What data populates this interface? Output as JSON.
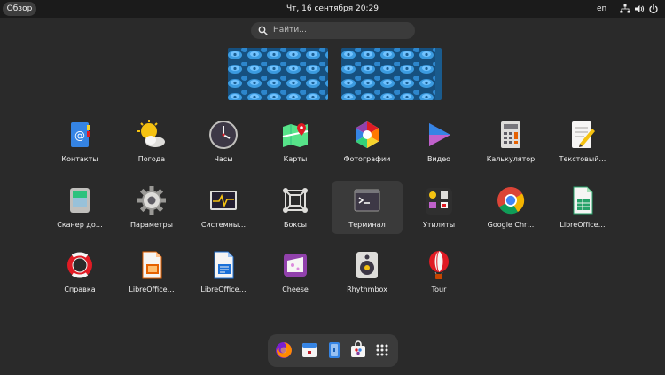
{
  "topbar": {
    "overview_label": "Обзор",
    "clock": "Чт, 16 сентября  20:29",
    "keyboard_layout": "en",
    "tray_icons": [
      "network-icon",
      "volume-icon",
      "power-icon"
    ]
  },
  "search": {
    "placeholder": "Найти..."
  },
  "workspaces": [
    {
      "name": "workspace-1"
    },
    {
      "name": "workspace-2"
    }
  ],
  "apps": [
    {
      "label": "Контакты",
      "icon": "contacts-icon"
    },
    {
      "label": "Погода",
      "icon": "weather-icon"
    },
    {
      "label": "Часы",
      "icon": "clock-icon"
    },
    {
      "label": "Карты",
      "icon": "maps-icon"
    },
    {
      "label": "Фотографии",
      "icon": "photos-icon"
    },
    {
      "label": "Видео",
      "icon": "videos-icon"
    },
    {
      "label": "Калькулятор",
      "icon": "calculator-icon"
    },
    {
      "label": "Текстовый…",
      "icon": "text-editor-icon"
    },
    {
      "label": "Сканер до…",
      "icon": "scanner-icon"
    },
    {
      "label": "Параметры",
      "icon": "settings-icon"
    },
    {
      "label": "Системны…",
      "icon": "system-monitor-icon"
    },
    {
      "label": "Боксы",
      "icon": "boxes-icon"
    },
    {
      "label": "Терминал",
      "icon": "terminal-icon",
      "selected": true
    },
    {
      "label": "Утилиты",
      "icon": "utilities-folder-icon"
    },
    {
      "label": "Google Chr…",
      "icon": "chrome-icon"
    },
    {
      "label": "LibreOffice…",
      "icon": "libreoffice-calc-icon"
    },
    {
      "label": "Справка",
      "icon": "help-icon"
    },
    {
      "label": "LibreOffice…",
      "icon": "libreoffice-impress-icon"
    },
    {
      "label": "LibreOffice…",
      "icon": "libreoffice-writer-icon"
    },
    {
      "label": "Cheese",
      "icon": "cheese-icon"
    },
    {
      "label": "Rhythmbox",
      "icon": "rhythmbox-icon"
    },
    {
      "label": "Tour",
      "icon": "tour-icon"
    }
  ],
  "dash": {
    "items": [
      "firefox-icon",
      "calendar-icon",
      "files-icon",
      "software-icon",
      "show-apps-icon"
    ]
  },
  "colors": {
    "background": "#2a2a2a",
    "topbar": "#1b1b1b",
    "search_bg": "#3b3b3b",
    "selected_tile": "#3a3a3a"
  }
}
